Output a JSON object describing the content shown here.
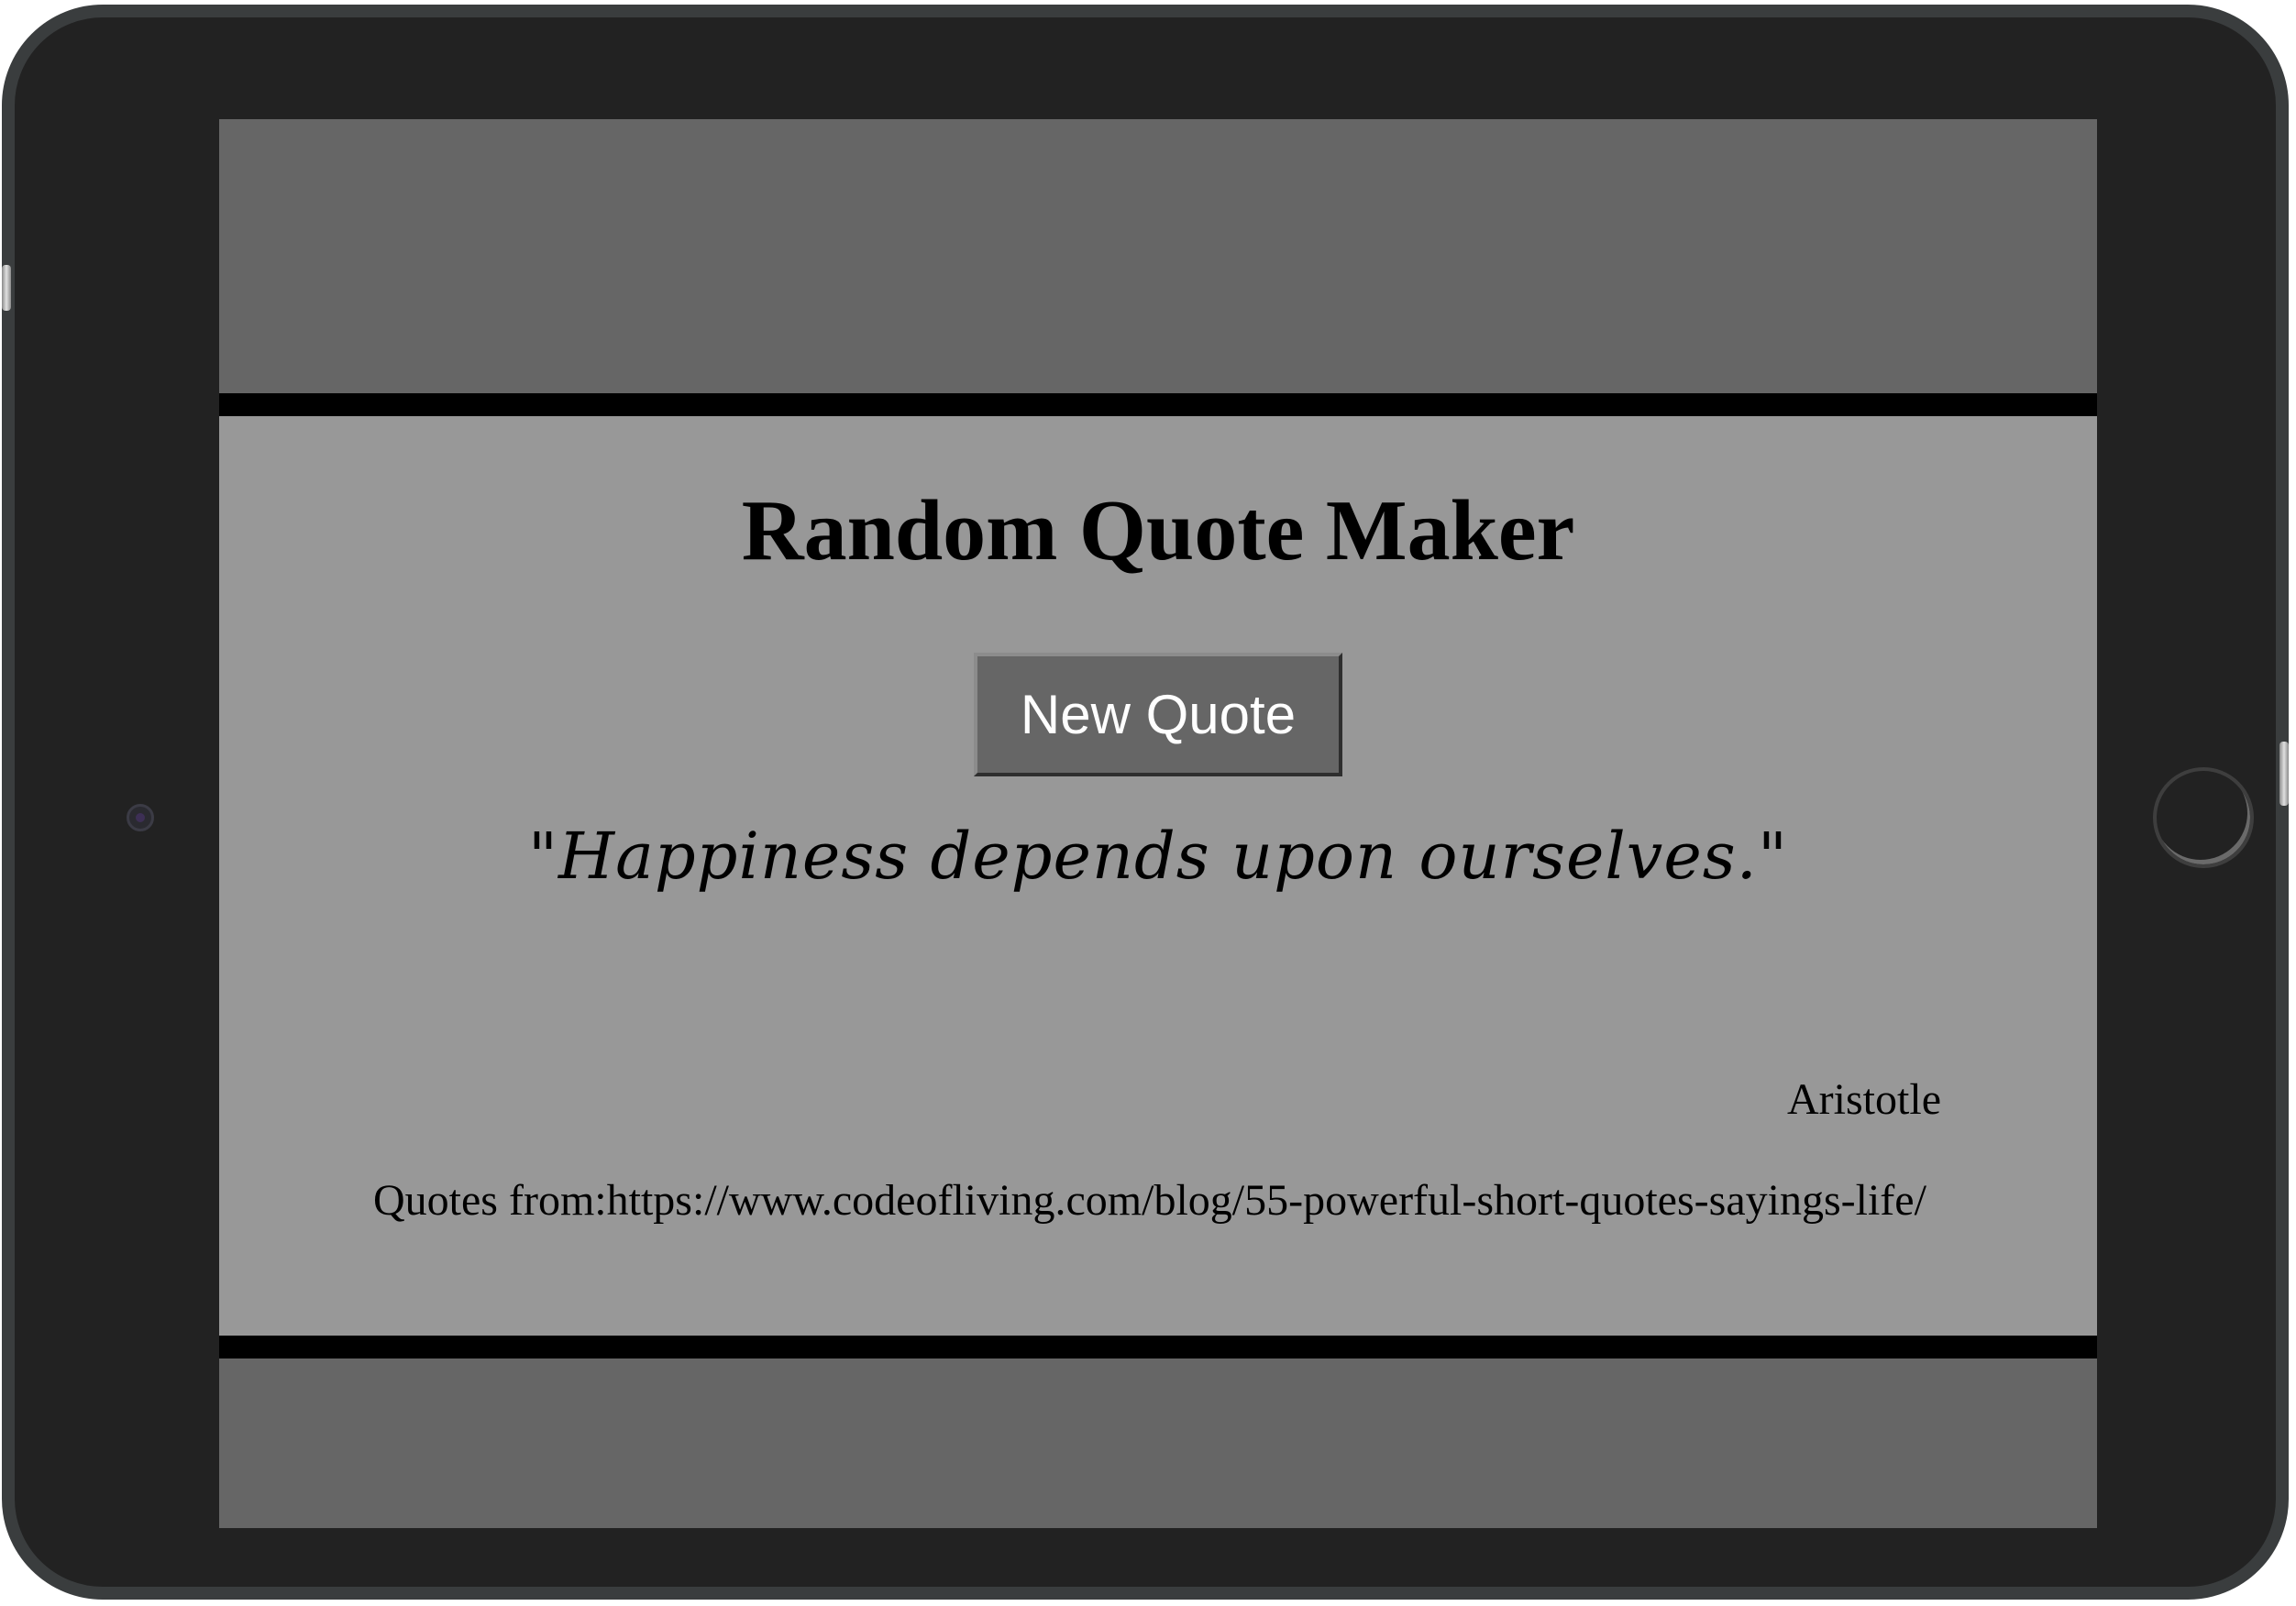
{
  "app": {
    "title": "Random Quote Maker"
  },
  "controls": {
    "new_quote_label": "New Quote"
  },
  "quote": {
    "text": "\"Happiness depends upon ourselves.\"",
    "author": "Aristotle"
  },
  "footer": {
    "source_text": "Quotes from:https://www.codeofliving.com/blog/55-powerful-short-quotes-sayings-life/"
  },
  "colors": {
    "device_bezel": "#222222",
    "screen_background": "#666666",
    "panel_background": "#989898",
    "panel_border": "#000000",
    "button_background": "#666666",
    "button_text": "#ffffff"
  },
  "icons": {
    "camera": "camera-icon",
    "home": "home-button-icon"
  }
}
